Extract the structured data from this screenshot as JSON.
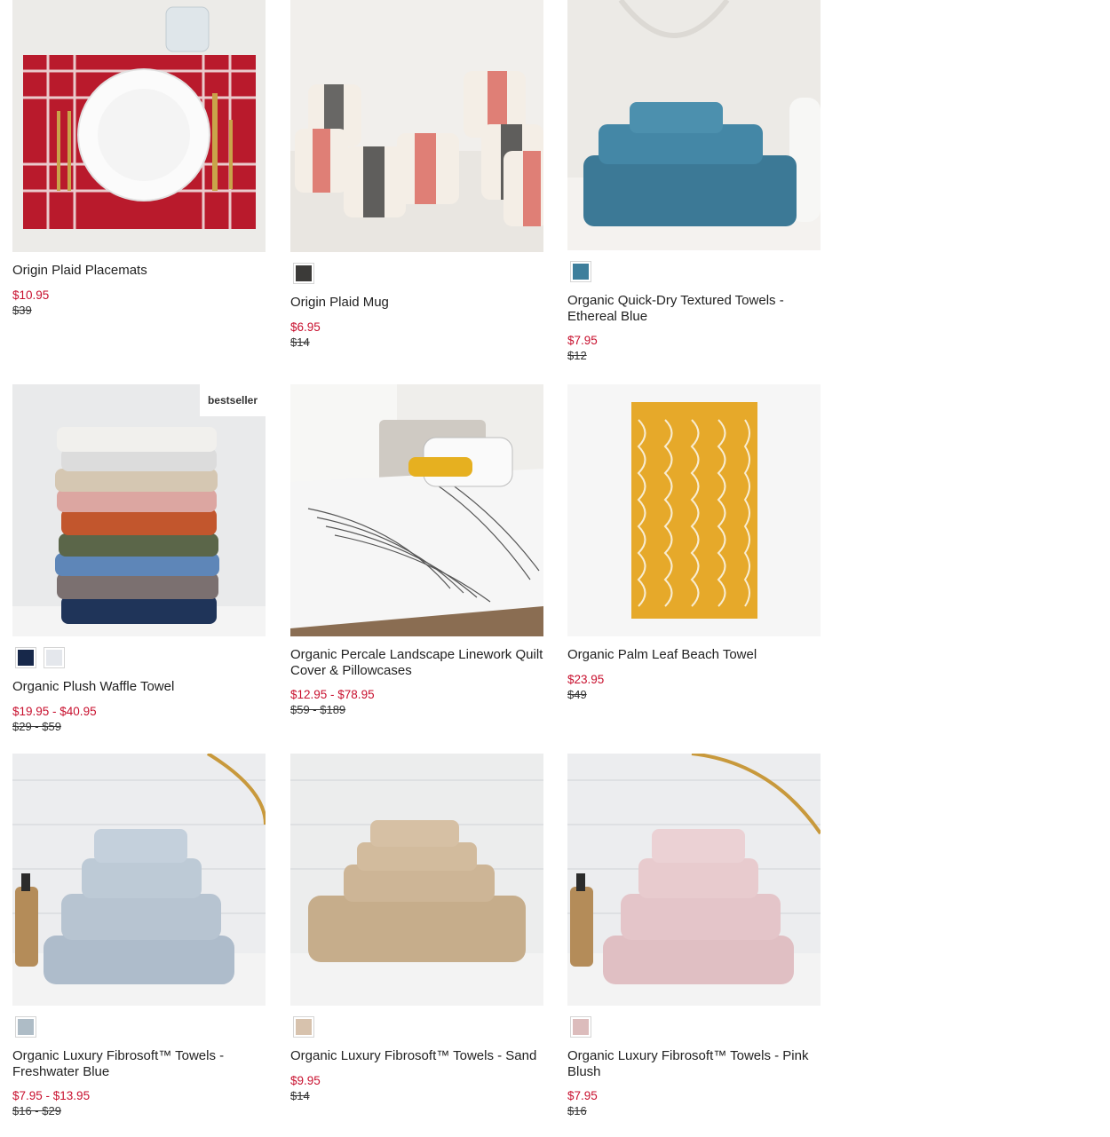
{
  "products": [
    {
      "name": "Origin Plaid Placemats",
      "price": "$10.95",
      "original_price": "$39",
      "swatches": []
    },
    {
      "name": "Origin Plaid Mug",
      "price": "$6.95",
      "original_price": "$14",
      "swatches": [
        "#3b3a38"
      ]
    },
    {
      "name": "Organic Quick-Dry Textured Towels - Ethereal Blue",
      "price": "$7.95",
      "original_price": "$12",
      "swatches": [
        "#3e7f9c"
      ]
    },
    {
      "name": "Organic Plush Waffle Towel",
      "price": "$19.95 - $40.95",
      "original_price": "$29 - $59",
      "swatches": [
        "#17284a",
        "#e4e7ec"
      ],
      "badge": "bestseller"
    },
    {
      "name": "Organic Percale Landscape Linework Quilt Cover & Pillowcases",
      "price": "$12.95 - $78.95",
      "original_price": "$59 - $189",
      "swatches": []
    },
    {
      "name": "Organic Palm Leaf Beach Towel",
      "price": "$23.95",
      "original_price": "$49",
      "swatches": []
    },
    {
      "name": "Organic Luxury Fibrosoft™ Towels - Freshwater Blue",
      "price": "$7.95 - $13.95",
      "original_price": "$16 - $29",
      "swatches": [
        "#aebcc6"
      ]
    },
    {
      "name": "Organic Luxury Fibrosoft™ Towels - Sand",
      "price": "$9.95",
      "original_price": "$14",
      "swatches": [
        "#d7c2ad"
      ]
    },
    {
      "name": "Organic Luxury Fibrosoft™ Towels - Pink Blush",
      "price": "$7.95",
      "original_price": "$16",
      "swatches": [
        "#dcbcbc"
      ]
    }
  ]
}
